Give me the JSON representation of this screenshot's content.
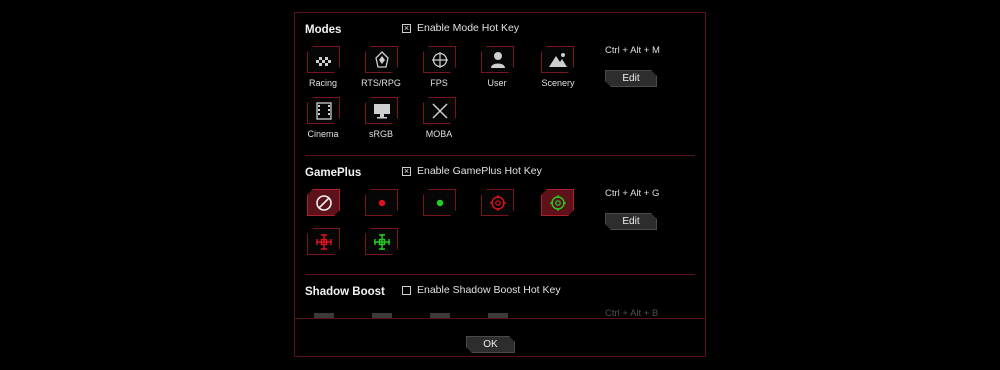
{
  "modes": {
    "title": "Modes",
    "hotkey_enabled_label": "Enable Mode Hot Key",
    "hotkey_checked": true,
    "hotkey": "Ctrl + Alt + M",
    "edit_label": "Edit",
    "items": [
      {
        "label": "Racing",
        "icon": "racing-flag-icon"
      },
      {
        "label": "RTS/RPG",
        "icon": "rts-rpg-icon"
      },
      {
        "label": "FPS",
        "icon": "crosshair-icon"
      },
      {
        "label": "User",
        "icon": "user-icon"
      },
      {
        "label": "Scenery",
        "icon": "mountain-icon"
      },
      {
        "label": "Cinema",
        "icon": "film-icon"
      },
      {
        "label": "sRGB",
        "icon": "monitor-icon"
      },
      {
        "label": "MOBA",
        "icon": "crossed-swords-icon"
      }
    ]
  },
  "gameplus": {
    "title": "GamePlus",
    "hotkey_enabled_label": "Enable GamePlus Hot Key",
    "hotkey_checked": true,
    "hotkey": "Ctrl + Alt + G",
    "edit_label": "Edit",
    "colors": {
      "red": "#e01020",
      "green": "#20d020",
      "active_bg": "#5c1218"
    }
  },
  "shadow_boost": {
    "title": "Shadow Boost",
    "hotkey_enabled_label": "Enable Shadow Boost Hot Key",
    "hotkey_checked": false,
    "hotkey": "Ctrl + Alt + B"
  },
  "dialog": {
    "ok_label": "OK",
    "accent_color": "#5a1218"
  }
}
